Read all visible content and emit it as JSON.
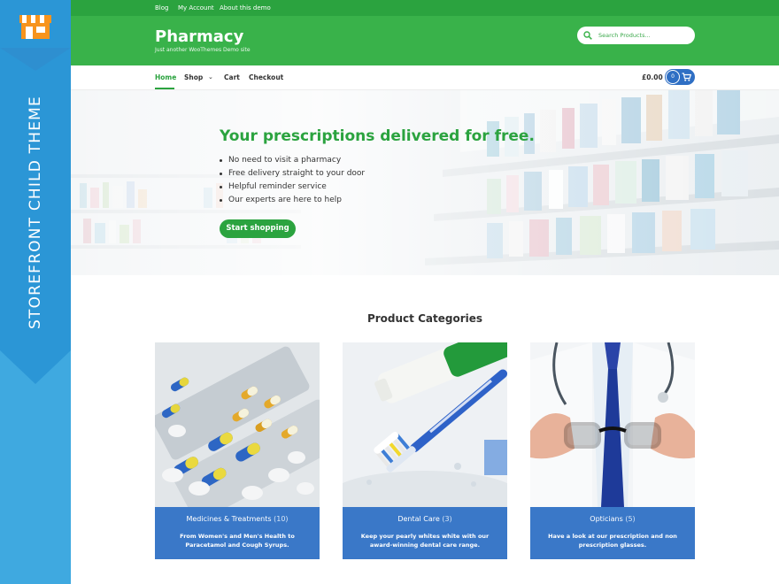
{
  "theme_strip": {
    "label": "STOREFRONT CHILD THEME",
    "icon": "storefront-shop-icon"
  },
  "topbar": {
    "links": [
      "Blog",
      "My Account",
      "About this demo"
    ]
  },
  "header": {
    "title": "Pharmacy",
    "tagline": "Just another WooThemes Demo site",
    "search_placeholder": "Search Products..."
  },
  "nav": {
    "items": [
      "Home",
      "Shop",
      "Cart",
      "Checkout"
    ],
    "active": "Home",
    "cart_total": "£0.00",
    "cart_count": "0"
  },
  "hero": {
    "title": "Your prescriptions delivered for free.",
    "bullets": [
      "No need to visit a pharmacy",
      "Free delivery straight to your door",
      "Helpful reminder service",
      "Our experts are here to help"
    ],
    "button": "Start shopping"
  },
  "categories": {
    "heading": "Product Categories",
    "items": [
      {
        "name": "Medicines & Treatments",
        "count": "(10)",
        "description": "From Women's and Men's Health to Paracetamol and Cough Syrups."
      },
      {
        "name": "Dental Care",
        "count": "(3)",
        "description": "Keep your pearly whites white with our award-winning dental care range."
      },
      {
        "name": "Opticians",
        "count": "(5)",
        "description": "Have a look at our prescription and non prescription glasses."
      }
    ]
  },
  "colors": {
    "green": "#39b24a",
    "dark_green": "#2ba33f",
    "blue": "#3a78c8",
    "strip_blue": "#3fa9e0"
  }
}
